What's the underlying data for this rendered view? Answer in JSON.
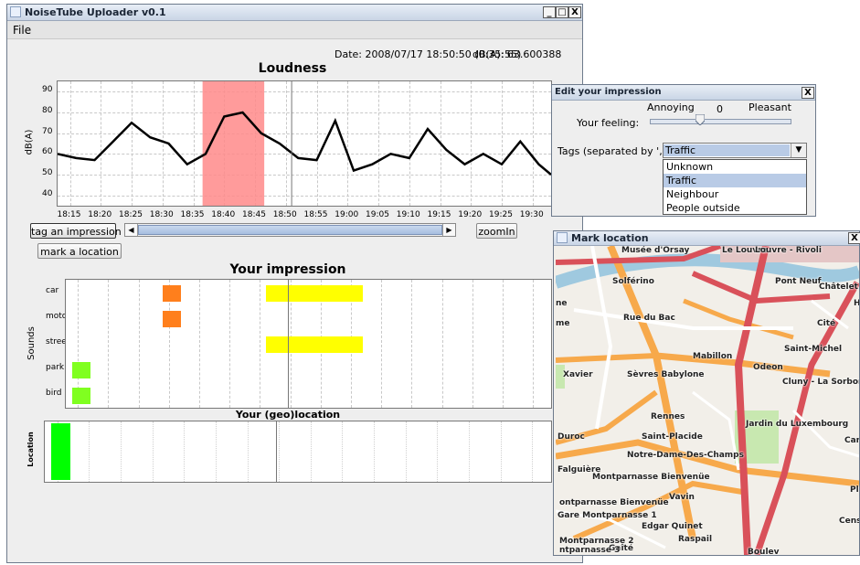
{
  "main_window": {
    "title": "NoiseTube Uploader v0.1",
    "menu": [
      "File"
    ],
    "controls": {
      "minimize": "_",
      "maximize": "□",
      "close": "X"
    }
  },
  "status": {
    "date_text": "Date: 2008/07/17 18:50:50  (0:35:55)",
    "dba_text": "dB(A): 63.600388"
  },
  "loudness": {
    "title": "Loudness",
    "ylabel": "dB(A)",
    "y_ticks": [
      "90",
      "80",
      "70",
      "60",
      "50",
      "40"
    ],
    "x_ticks": [
      "18:15",
      "18:20",
      "18:25",
      "18:30",
      "18:35",
      "18:40",
      "18:45",
      "18:50",
      "18:55",
      "19:00",
      "19:05",
      "19:10",
      "19:15",
      "19:20",
      "19:25",
      "19:30"
    ],
    "selection": {
      "from": "18:36:30",
      "to": "18:46:30",
      "color": "#ff8a8a"
    }
  },
  "chart_data": [
    {
      "type": "line",
      "title": "Loudness",
      "xlabel": "",
      "ylabel": "dB(A)",
      "ylim": [
        35,
        95
      ],
      "x_range": [
        "18:13",
        "19:33"
      ],
      "grid": true,
      "x": [
        "18:13",
        "18:16",
        "18:19",
        "18:22",
        "18:25",
        "18:28",
        "18:31",
        "18:34",
        "18:37",
        "18:40",
        "18:43",
        "18:46",
        "18:49",
        "18:52",
        "18:55",
        "18:58",
        "19:01",
        "19:04",
        "19:07",
        "19:10",
        "19:13",
        "19:16",
        "19:19",
        "19:22",
        "19:25",
        "19:28",
        "19:31",
        "19:33"
      ],
      "series": [
        {
          "name": "",
          "values": [
            60,
            58,
            57,
            66,
            75,
            68,
            65,
            55,
            60,
            78,
            80,
            70,
            65,
            58,
            57,
            76,
            52,
            55,
            60,
            58,
            72,
            62,
            55,
            60,
            55,
            66,
            55,
            50
          ]
        }
      ]
    },
    {
      "type": "bar",
      "title": "Your impression",
      "ylabel": "Sounds",
      "categories": [
        "car",
        "motor",
        "street",
        "park",
        "bird"
      ],
      "series": [
        {
          "category": "car",
          "from": "18:29",
          "to": "18:32",
          "color": "#ff7f1c"
        },
        {
          "category": "motor",
          "from": "18:29",
          "to": "18:32",
          "color": "#ff7f1c"
        },
        {
          "category": "car",
          "from": "18:46",
          "to": "19:02",
          "color": "#ffff00"
        },
        {
          "category": "street",
          "from": "18:46",
          "to": "19:02",
          "color": "#ffff00"
        },
        {
          "category": "park",
          "from": "18:14",
          "to": "18:17",
          "color": "#80ff20"
        },
        {
          "category": "bird",
          "from": "18:14",
          "to": "18:17",
          "color": "#80ff20"
        }
      ]
    },
    {
      "type": "bar",
      "title": "Your (geo)location",
      "ylabel": "Location",
      "series": [
        {
          "from": "18:14",
          "to": "18:17",
          "color": "#00ff00"
        }
      ]
    }
  ],
  "buttons": {
    "tag_impression": "tag an impression",
    "mark_location": "mark a location",
    "zoom_in": "zoomIn"
  },
  "impression": {
    "title": "Your impression",
    "ylabel": "Sounds",
    "categories": [
      "car",
      "motor",
      "street",
      "park",
      "bird"
    ]
  },
  "geo": {
    "title": "Your (geo)location",
    "ylabel": "Location"
  },
  "edit_dialog": {
    "title": "Edit your impression",
    "annoying": "Annoying",
    "zero": "0",
    "pleasant": "Pleasant",
    "feeling_label": "Your feeling:",
    "slider_value": 0,
    "tags_label": "Tags (separated by ',')",
    "tags_value": "Traffic",
    "options": [
      "Unknown",
      "Traffic",
      "Neighbour",
      "People outside"
    ],
    "highlighted_option": "Traffic",
    "close": "X"
  },
  "map_window": {
    "title": "Mark location",
    "close": "X",
    "labels": [
      "Musée d'Orsay",
      "Le Louvre",
      "Louvre - Rivoli",
      "Solférino",
      "Pont Neuf",
      "Châtelet",
      "Rue du Bac",
      "Cité",
      "Saint-Michel",
      "Mabillon",
      "Odeon",
      "Sèvres Babylone",
      "Cluny - La Sorbonne",
      "Rennes",
      "Saint-Placide",
      "Notre-Dame-Des-Champs",
      "Jardin du Luxembourg",
      "Falguière",
      "Montparnasse Bienvenüe",
      "Vavin",
      "Gare Montparnasse 1",
      "Edgar Quinet",
      "Raspail",
      "Gaîté",
      "Duroc",
      "Xavier",
      "ne",
      "me",
      "Card",
      "Censi",
      "Pl",
      "H",
      "Montparnasse 2",
      "ntparnasse 3",
      "ontparnasse Bienvenüe",
      "Boulev"
    ]
  }
}
